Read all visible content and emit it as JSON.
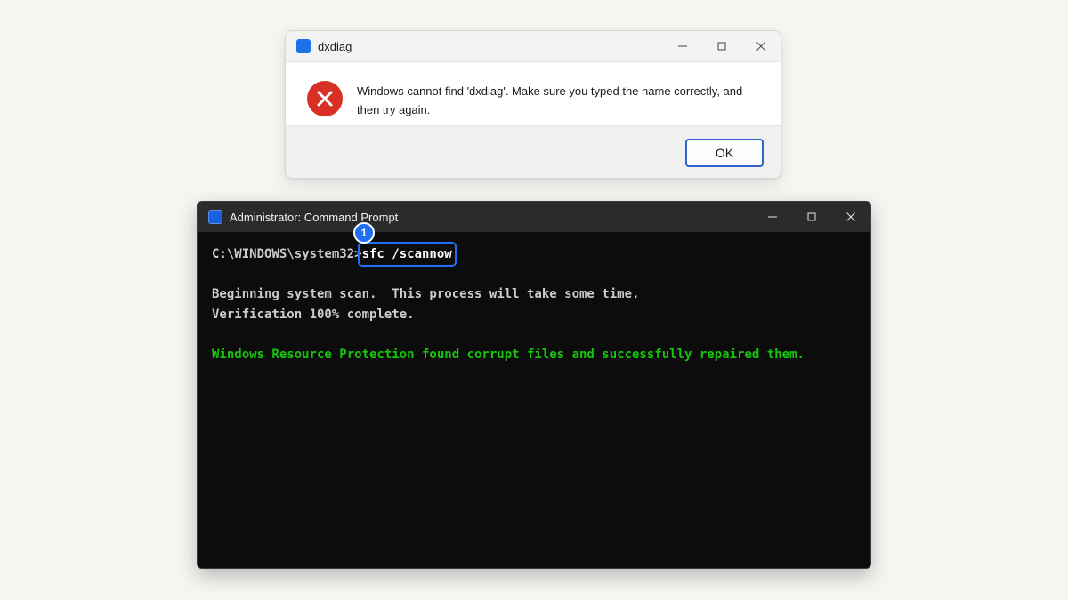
{
  "dialog": {
    "title": "dxdiag",
    "message": "Windows cannot find 'dxdiag'. Make sure you typed the name correctly, and then try again.",
    "ok_label": "OK",
    "icon": "error-x-icon",
    "app_icon_color": "#1a73e8",
    "error_color": "#d93025"
  },
  "terminal": {
    "title": "Administrator: Command Prompt",
    "app_icon_color": "#1a5fe0",
    "prompt": "C:\\WINDOWS\\system32>",
    "command": "sfc /scannow",
    "lines": [
      "Beginning system scan.  This process will take some time.",
      "Verification 100% complete."
    ],
    "result": "Windows Resource Protection found corrupt files and successfully repaired them.",
    "result_color": "#16c60c"
  },
  "annotation": {
    "step_number": "1",
    "highlight_color": "#1e6ff2"
  }
}
